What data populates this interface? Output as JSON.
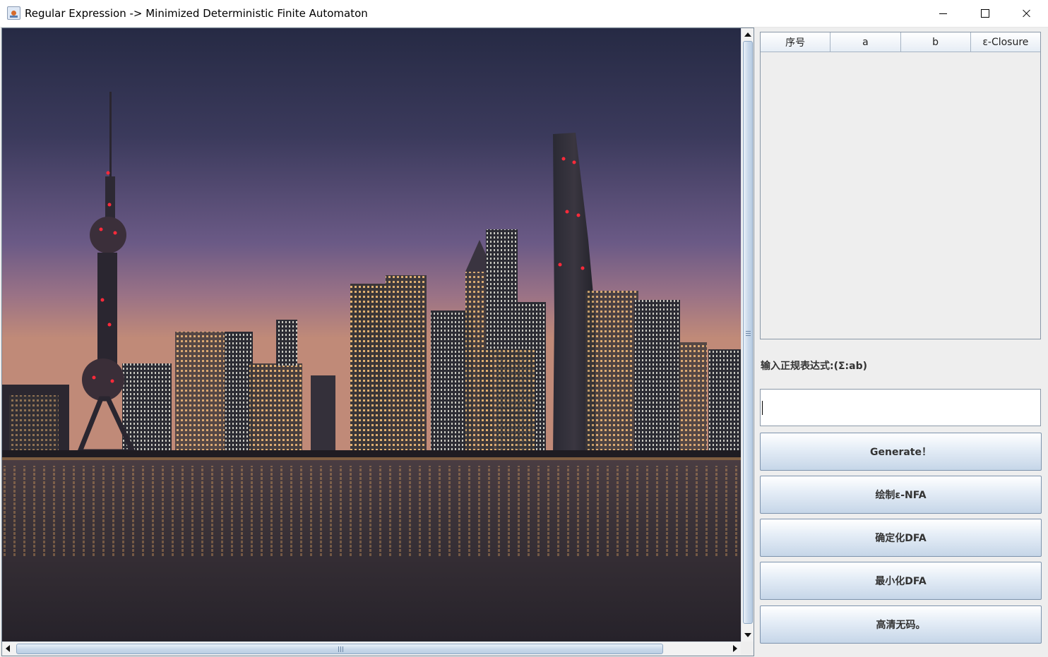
{
  "window": {
    "title": "Regular Expression -> Minimized Deterministic Finite Automaton"
  },
  "image_pane": {
    "image_subject": "Shanghai skyline at dusk"
  },
  "table": {
    "columns": [
      "序号",
      "a",
      "b",
      "ε-Closure"
    ],
    "rows": []
  },
  "regex": {
    "label": "输入正规表达式:(Σ:ab)",
    "value": ""
  },
  "buttons": {
    "generate": "Generate！",
    "draw_nfa": "绘制ε-NFA",
    "determinize_dfa": "确定化DFA",
    "minimize_dfa": "最小化DFA",
    "hd": "高清无码。"
  },
  "colors": {
    "sky_top": "#2a2e48",
    "sky_mid": "#6b5a86",
    "horizon": "#c08a78",
    "water": "#2a2630",
    "button_gradient_bottom": "#c6d6e8"
  }
}
